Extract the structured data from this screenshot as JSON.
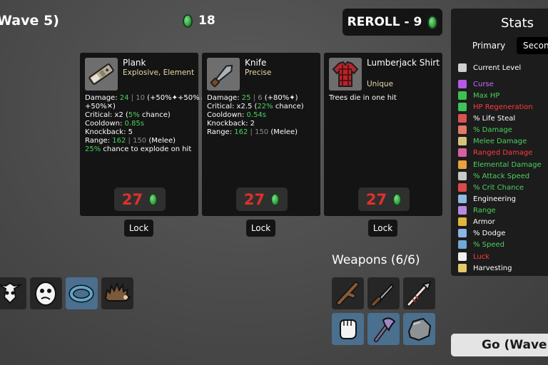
{
  "header": {
    "wave_title": "Wave 5)",
    "materials_count": "18",
    "reroll_label": "REROLL - 9"
  },
  "shop": {
    "items": [
      {
        "name": "Plank",
        "tags": "Explosive, Element",
        "icon": "plank-icon",
        "price": "27",
        "lock_label": "Lock",
        "stats": {
          "damage_label": "Damage: ",
          "damage_value": "24",
          "damage_sep": " | ",
          "damage_base": "10",
          "damage_scaling": " (+50%✦+50%💧",
          "damage_scaling2": "+50%✕)",
          "critical_label": "Critical: x2 (",
          "critical_value": "5%",
          "critical_suffix": " chance)",
          "cooldown_label": "Cooldown: ",
          "cooldown_value": "0.85s",
          "knockback": "Knockback: 5",
          "range_label": "Range: ",
          "range_value": "162",
          "range_base": "150",
          "range_suffix": " (Melee)",
          "effect_value": "25%",
          "effect_text": " chance to explode on hit"
        }
      },
      {
        "name": "Knife",
        "tags": "Precise",
        "icon": "knife-icon",
        "price": "27",
        "lock_label": "Lock",
        "stats": {
          "damage_label": "Damage: ",
          "damage_value": "25",
          "damage_sep": " | ",
          "damage_base": "6",
          "damage_scaling": " (+80%✦)",
          "critical_label": "Critical: x2.5 (",
          "critical_value": "22%",
          "critical_suffix": " chance)",
          "cooldown_label": "Cooldown: ",
          "cooldown_value": "0.54s",
          "knockback": "Knockback: 2",
          "range_label": "Range: ",
          "range_value": "162",
          "range_base": "150",
          "range_suffix": " (Melee)"
        }
      },
      {
        "name": "Lumberjack Shirt",
        "tags": "Unique",
        "icon": "lumberjack-shirt-icon",
        "price": "27",
        "lock_label": "Lock",
        "description": "Trees die in one hit"
      }
    ]
  },
  "stats_panel": {
    "title": "Stats",
    "tab_primary": "Primary",
    "tab_secondary": "Secondary",
    "rows": [
      {
        "label": "Current Level",
        "color": "#ffffff",
        "icon": "level-icon"
      },
      {
        "label": "Curse",
        "color": "#c86bff",
        "icon": "curse-icon"
      },
      {
        "label": "Max HP",
        "color": "#4bd25e",
        "icon": "heart-icon"
      },
      {
        "label": "HP Regeneration",
        "color": "#ff3b3b",
        "icon": "regen-icon"
      },
      {
        "label": "% Life Steal",
        "color": "#ffffff",
        "icon": "life-steal-icon"
      },
      {
        "label": "% Damage",
        "color": "#4bd25e",
        "icon": "damage-icon"
      },
      {
        "label": "Melee Damage",
        "color": "#4bd25e",
        "icon": "melee-icon"
      },
      {
        "label": "Ranged Damage",
        "color": "#ff3b3b",
        "icon": "ranged-icon"
      },
      {
        "label": "Elemental Damage",
        "color": "#4bd25e",
        "icon": "elemental-icon"
      },
      {
        "label": "% Attack Speed",
        "color": "#4bd25e",
        "icon": "attack-speed-icon"
      },
      {
        "label": "% Crit Chance",
        "color": "#4bd25e",
        "icon": "crit-icon"
      },
      {
        "label": "Engineering",
        "color": "#ffffff",
        "icon": "engineering-icon"
      },
      {
        "label": "Range",
        "color": "#4bd25e",
        "icon": "range-icon"
      },
      {
        "label": "Armor",
        "color": "#ffffff",
        "icon": "armor-icon"
      },
      {
        "label": "% Dodge",
        "color": "#ffffff",
        "icon": "dodge-icon"
      },
      {
        "label": "% Speed",
        "color": "#4bd25e",
        "icon": "speed-icon"
      },
      {
        "label": "Luck",
        "color": "#ff3b3b",
        "icon": "luck-icon"
      },
      {
        "label": "Harvesting",
        "color": "#ffffff",
        "icon": "harvesting-icon"
      }
    ]
  },
  "weapons": {
    "title": "Weapons (6/6)",
    "slots": [
      {
        "icon": "stick-icon"
      },
      {
        "icon": "knife-icon"
      },
      {
        "icon": "spear-icon"
      },
      {
        "icon": "fist-icon"
      },
      {
        "icon": "axe-icon"
      },
      {
        "icon": "rock-icon"
      }
    ]
  },
  "owned_items": [
    {
      "icon": "skull-icon"
    },
    {
      "icon": "ghost-face-icon"
    },
    {
      "icon": "ring-icon"
    },
    {
      "icon": "hedgehog-icon"
    }
  ],
  "go_button": "Go (Wave"
}
